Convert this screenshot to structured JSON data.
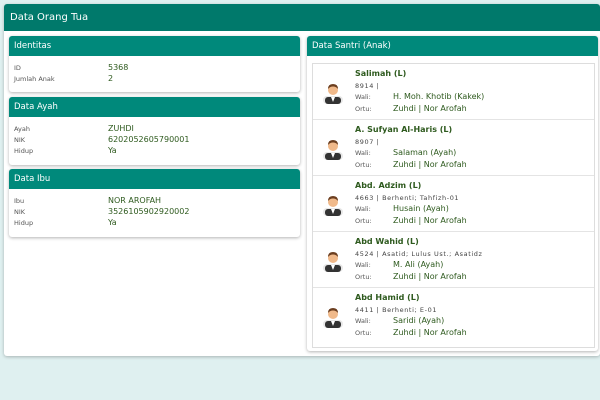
{
  "header": {
    "title": "Data Orang Tua"
  },
  "identitas": {
    "title": "Identitas",
    "rows": [
      {
        "label": "ID",
        "value": "5368"
      },
      {
        "label": "Jumlah Anak",
        "value": "2"
      }
    ]
  },
  "ayah": {
    "title": "Data Ayah",
    "rows": [
      {
        "label": "Ayah",
        "value": "ZUHDI"
      },
      {
        "label": "NIK",
        "value": "6202052605790001"
      },
      {
        "label": "Hidup",
        "value": "Ya"
      }
    ]
  },
  "ibu": {
    "title": "Data Ibu",
    "rows": [
      {
        "label": "Ibu",
        "value": "NOR AROFAH"
      },
      {
        "label": "NIK",
        "value": "3526105902920002"
      },
      {
        "label": "Hidup",
        "value": "Ya"
      }
    ]
  },
  "santri": {
    "title": "Data Santri (Anak)",
    "wali_label": "Wali:",
    "ortu_label": "Ortu:",
    "items": [
      {
        "name": "Salimah (L)",
        "meta": "8914 |",
        "wali": "H. Moh. Khotib (Kakek)",
        "ortu": "Zuhdi | Nor Arofah"
      },
      {
        "name": "A. Sufyan Al-Haris (L)",
        "meta": "8907 |",
        "wali": "Salaman (Ayah)",
        "ortu": "Zuhdi | Nor Arofah"
      },
      {
        "name": "Abd. Adzim (L)",
        "meta": "4663 | Berhenti; Tahfizh-01",
        "wali": "Husain (Ayah)",
        "ortu": "Zuhdi | Nor Arofah"
      },
      {
        "name": "Abd Wahid (L)",
        "meta": "4524 | Asatid; Lulus Ust.; Asatidz",
        "wali": "M. Ali (Ayah)",
        "ortu": "Zuhdi | Nor Arofah"
      },
      {
        "name": "Abd Hamid (L)",
        "meta": "4411 | Berhenti; E-01",
        "wali": "Saridi (Ayah)",
        "ortu": "Zuhdi | Nor Arofah"
      }
    ]
  }
}
